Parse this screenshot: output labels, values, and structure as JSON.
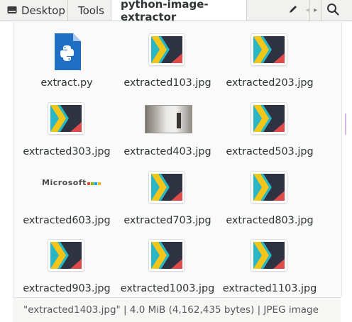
{
  "toolbar": {
    "breadcrumbs": [
      {
        "label": "Desktop",
        "icon": "drive-icon"
      },
      {
        "label": "Tools"
      },
      {
        "label": "python-image-extractor",
        "active": true
      }
    ],
    "edit_icon": "pencil-icon",
    "back_icon": "chevron-left-icon",
    "forward_icon": "chevron-right-icon",
    "search_icon": "search-icon"
  },
  "files": [
    {
      "name": "extract.py",
      "kind": "python"
    },
    {
      "name": "extracted103.jpg",
      "kind": "jpg-logo"
    },
    {
      "name": "extracted203.jpg",
      "kind": "jpg-logo"
    },
    {
      "name": "extracted303.jpg",
      "kind": "jpg-logo"
    },
    {
      "name": "extracted403.jpg",
      "kind": "jpg-photo"
    },
    {
      "name": "extracted503.jpg",
      "kind": "jpg-logo"
    },
    {
      "name": "extracted603.jpg",
      "kind": "jpg-text"
    },
    {
      "name": "extracted703.jpg",
      "kind": "jpg-logo"
    },
    {
      "name": "extracted803.jpg",
      "kind": "jpg-logo"
    },
    {
      "name": "extracted903.jpg",
      "kind": "jpg-logo"
    },
    {
      "name": "extracted1003.jpg",
      "kind": "jpg-logo"
    },
    {
      "name": "extracted1103.jpg",
      "kind": "jpg-logo"
    }
  ],
  "thumb_text": "Microsoft",
  "status": "\"extracted1403.jpg\" | 4.0 MiB (4,162,435 bytes) | JPEG image",
  "colors": {
    "python_blue": "#1f6fc5",
    "logo_dark": "#2f3341",
    "logo_teal": "#29b6c5",
    "logo_yellow": "#f5c518",
    "logo_red": "#e04a4a"
  }
}
